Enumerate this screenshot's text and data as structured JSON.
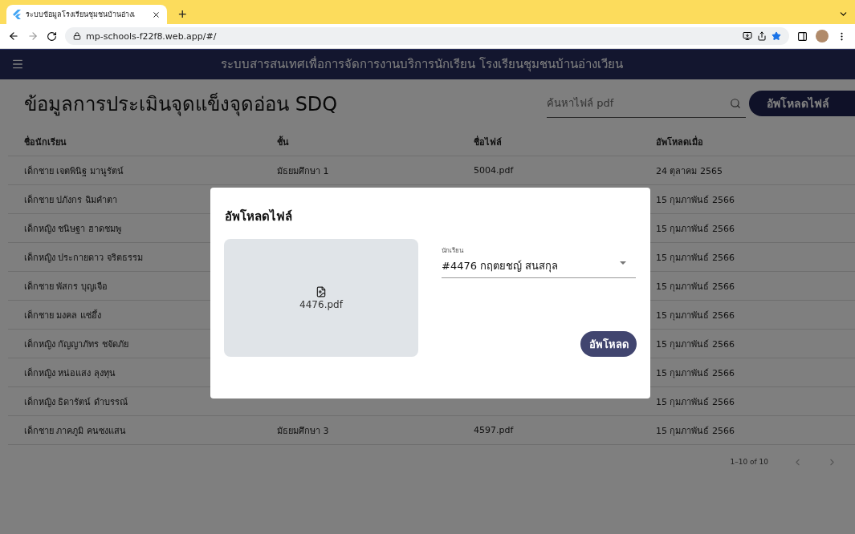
{
  "browser": {
    "tab_title": "ระบบข้อมูลโรงเรียนชุมชนบ้านอ่างเ",
    "new_tab": "+",
    "url": "mp-schools-f22f8.web.app/#/"
  },
  "app_bar": {
    "title": "ระบบสารสนเทศเพื่อการจัดการงานบริการนักเรียน โรงเรียนชุมชนบ้านอ่างเวียน"
  },
  "page": {
    "title": "ข้อมูลการประเมินจุดแข็งจุดอ่อน SDQ",
    "search": {
      "placeholder": "ค้นหาไฟล์ pdf"
    },
    "upload_button": "อัพโหลดไฟล์"
  },
  "table": {
    "columns": [
      "ชื่อนักเรียน",
      "ชั้น",
      "ชื่อไฟล์",
      "อัพโหลดเมื่อ"
    ],
    "rows": [
      {
        "name": "เด็กชาย เจตพินิฐ มานูรัตน์",
        "class": "มัธยมศึกษา 1",
        "file": "5004.pdf",
        "uploaded": "24 ตุลาคม 2565"
      },
      {
        "name": "เด็กชาย ปภังกร ฉิมคำตา",
        "uploaded": "15 กุมภาพันธ์ 2566"
      },
      {
        "name": "เด็กหญิง ชนิษฐา ฮาดชมพู",
        "uploaded": "15 กุมภาพันธ์ 2566"
      },
      {
        "name": "เด็กหญิง ประกายดาว จริตธรรม",
        "uploaded": "15 กุมภาพันธ์ 2566"
      },
      {
        "name": "เด็กชาย พัสกร บุญเจือ",
        "uploaded": "15 กุมภาพันธ์ 2566"
      },
      {
        "name": "เด็กชาย มงคล แซ่อึ้ง",
        "uploaded": "15 กุมภาพันธ์ 2566"
      },
      {
        "name": "เด็กหญิง กัญญาภัทร ชจัดภัย",
        "uploaded": "15 กุมภาพันธ์ 2566"
      },
      {
        "name": "เด็กหญิง หน่อแสง ลุงทุน",
        "uploaded": "15 กุมภาพันธ์ 2566"
      },
      {
        "name": "เด็กหญิง ธิดารัตน์ ดำบรรณ์",
        "uploaded": "15 กุมภาพันธ์ 2566"
      },
      {
        "name": "เด็กชาย ภาคภูมิ คนซงแสน",
        "class": "มัธยมศึกษา 3",
        "file": "4597.pdf",
        "uploaded": "15 กุมภาพันธ์ 2566"
      }
    ],
    "pagination": {
      "range": "1–10 of 10"
    }
  },
  "dialog": {
    "title": "อัพโหลดไฟล์",
    "file_name": "4476.pdf",
    "student_field": {
      "label": "นักเรียน",
      "value": "#4476 กฤตยชญ์ สนสกุล"
    },
    "upload_button": "อัพโหลด"
  }
}
